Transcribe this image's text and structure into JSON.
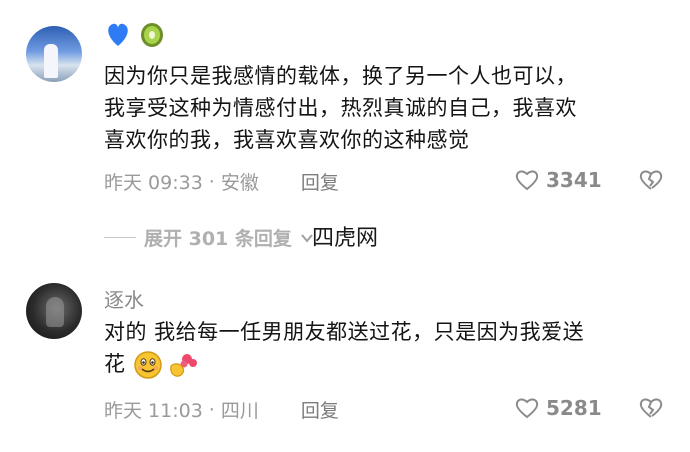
{
  "comments": [
    {
      "username": "",
      "text_lines": [
        "因为你只是我感情的载体，换了另一个人也可以，",
        "我享受这种为情感付出，热烈真诚的自己，我喜欢",
        "喜欢你的我，我喜欢喜欢你的这种感觉"
      ],
      "time": "昨天 09:33",
      "location": "安徽",
      "reply_label": "回复",
      "likes": "3341",
      "badge_icons": [
        "blue-heart-icon",
        "kiwi-icon"
      ],
      "colors": {
        "blue_heart": "#2f7bf5",
        "kiwi": "#8bbf2b"
      }
    },
    {
      "username": "逐水",
      "text_line1": "对的 我给每一任男朋友都送过花，只是因为我爱送",
      "text_line2": "花",
      "time": "昨天 11:03",
      "location": "四川",
      "reply_label": "回复",
      "likes": "5281",
      "emoji_icons": [
        "smiling-face-icon",
        "bouquet-hand-icon"
      ]
    }
  ],
  "expand": {
    "label": "展开 301 条回复"
  },
  "watermark": "四虎网",
  "separator": "·"
}
